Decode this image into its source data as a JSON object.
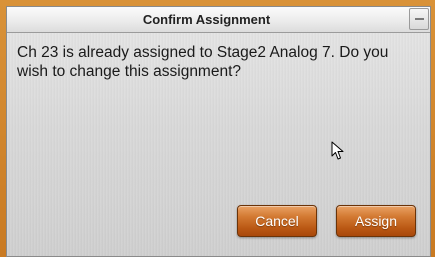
{
  "dialog": {
    "title": "Confirm Assignment",
    "message": "Ch 23 is already assigned to Stage2 Analog 7. Do you wish to change this assignment?"
  },
  "buttons": {
    "cancel_label": "Cancel",
    "assign_label": "Assign"
  },
  "colors": {
    "frame_orange": "#c97a22",
    "button_orange": "#c86a22",
    "panel_gray": "#d9d9d9"
  },
  "icons": {
    "titlebar_button": "minimize-icon",
    "pointer": "mouse-cursor-icon"
  }
}
